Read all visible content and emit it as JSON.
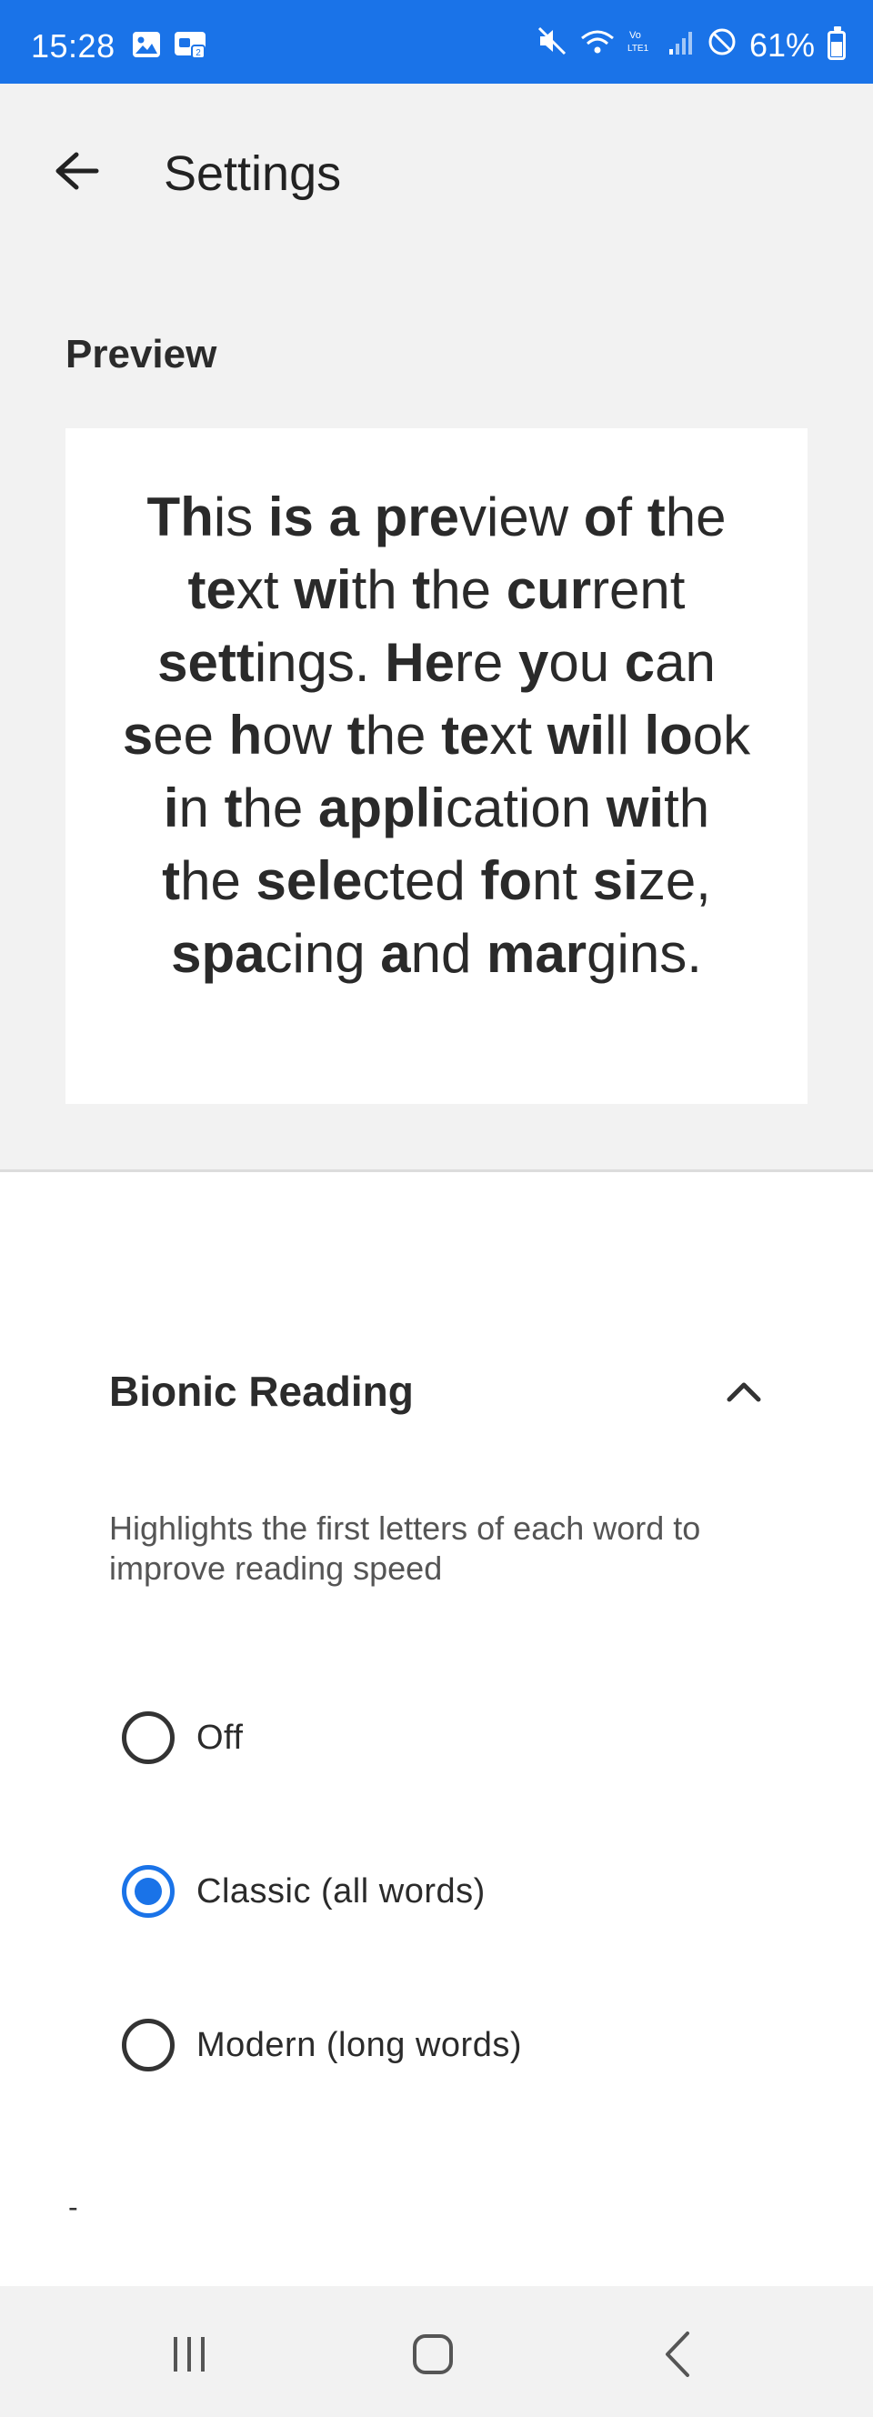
{
  "status_bar": {
    "time": "15:28",
    "battery": "61%",
    "battery_level": 0.61,
    "icons": [
      "image-icon",
      "screen-share-icon",
      "mute-icon",
      "wifi-icon",
      "volte-icon",
      "signal-icon",
      "do-not-disturb-icon",
      "battery-icon"
    ]
  },
  "header": {
    "title": "Settings",
    "back_icon": "arrow-back-icon"
  },
  "preview": {
    "heading": "Preview",
    "words": [
      {
        "b": "Th",
        "r": "is"
      },
      {
        "b": "is",
        "r": ""
      },
      {
        "b": "a",
        "r": ""
      },
      {
        "b": "pre",
        "r": "view"
      },
      {
        "b": "o",
        "r": "f"
      },
      {
        "b": "t",
        "r": "he"
      },
      {
        "b": "te",
        "r": "xt"
      },
      {
        "b": "wi",
        "r": "th"
      },
      {
        "b": "t",
        "r": "he"
      },
      {
        "b": "cur",
        "r": "rent"
      },
      {
        "b": "sett",
        "r": "ings."
      },
      {
        "b": "He",
        "r": "re"
      },
      {
        "b": "y",
        "r": "ou"
      },
      {
        "b": "c",
        "r": "an"
      },
      {
        "b": "s",
        "r": "ee"
      },
      {
        "b": "h",
        "r": "ow"
      },
      {
        "b": "t",
        "r": "he"
      },
      {
        "b": "te",
        "r": "xt"
      },
      {
        "b": "wi",
        "r": "ll"
      },
      {
        "b": "lo",
        "r": "ok"
      },
      {
        "b": "i",
        "r": "n"
      },
      {
        "b": "t",
        "r": "he"
      },
      {
        "b": "appli",
        "r": "cation"
      },
      {
        "b": "wi",
        "r": "th"
      },
      {
        "b": "t",
        "r": "he"
      },
      {
        "b": "sele",
        "r": "cted"
      },
      {
        "b": "fo",
        "r": "nt"
      },
      {
        "b": "si",
        "r": "ze,"
      },
      {
        "b": "spa",
        "r": "cing"
      },
      {
        "b": "a",
        "r": "nd"
      },
      {
        "b": "mar",
        "r": "gins."
      }
    ]
  },
  "bionic": {
    "title": "Bionic Reading",
    "toggle_icon": "chevron-up-icon",
    "description": "Highlights the first letters of each word to improve reading speed",
    "options": [
      {
        "label": "Off",
        "selected": false
      },
      {
        "label": "Classic (all words)",
        "selected": true
      },
      {
        "label": "Modern (long words)",
        "selected": false
      }
    ],
    "stray_text": "-"
  },
  "nav": {
    "icons": [
      "recent-apps-icon",
      "home-icon",
      "back-nav-icon"
    ]
  },
  "colors": {
    "accent": "#1a73e8",
    "background": "#f2f2f2",
    "card": "#ffffff"
  }
}
